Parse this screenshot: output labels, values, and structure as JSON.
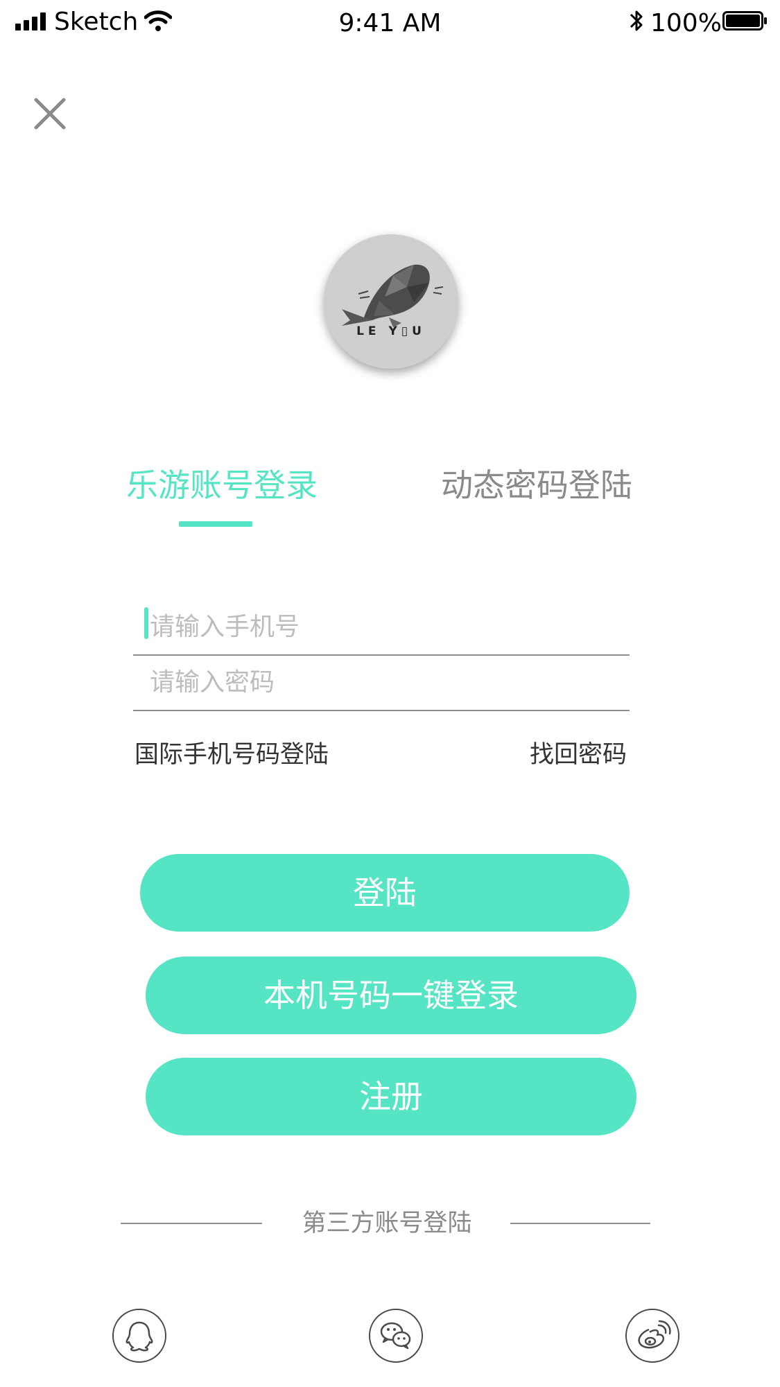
{
  "status_bar": {
    "carrier": "Sketch",
    "time": "9:41 AM",
    "battery": "100%",
    "icons": [
      "signal-icon",
      "wifi-icon",
      "bluetooth-icon",
      "battery-icon"
    ]
  },
  "logo": {
    "text": "LE Y▯U",
    "icon": "whale-logo-icon"
  },
  "tabs": [
    {
      "label": "乐游账号登录",
      "active": true
    },
    {
      "label": "动态密码登陆",
      "active": false
    }
  ],
  "form": {
    "phone_placeholder": "请输入手机号",
    "password_placeholder": "请输入密码",
    "intl_link": "国际手机号码登陆",
    "forgot_link": "找回密码"
  },
  "buttons": {
    "login": "登陆",
    "one_key": "本机号码一键登录",
    "register": "注册"
  },
  "third_party": {
    "label": "第三方账号登陆",
    "icons": [
      "qq-icon",
      "wechat-icon",
      "weibo-icon"
    ]
  },
  "colors": {
    "accent": "#55e4c4",
    "inactive_tab": "#8a8a8a",
    "placeholder": "#bdbdbd",
    "divider": "#8e8e8e"
  }
}
